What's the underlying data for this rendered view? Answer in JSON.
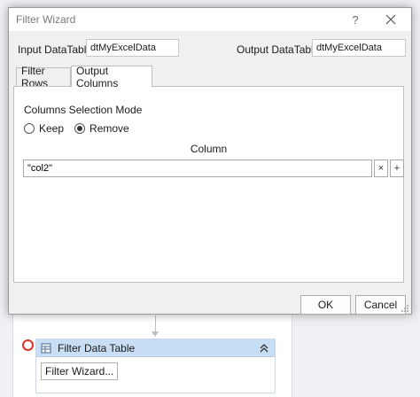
{
  "dialog": {
    "title": "Filter Wizard",
    "help_glyph": "?",
    "input_label": "Input DataTable",
    "input_value": "dtMyExcelData",
    "output_label": "Output DataTable",
    "output_value": "dtMyExcelData",
    "tabs": [
      {
        "label": "Filter Rows",
        "active": false
      },
      {
        "label": "Output Columns",
        "active": true
      }
    ],
    "mode_label": "Columns Selection Mode",
    "radio_keep": "Keep",
    "radio_remove": "Remove",
    "selected_mode": "Remove",
    "column_header": "Column",
    "column_value": "\"col2\"",
    "remove_glyph": "×",
    "add_glyph": "+",
    "ok_label": "OK",
    "cancel_label": "Cancel"
  },
  "designer": {
    "activity_title": "Filter Data Table",
    "activity_button": "Filter Wizard..."
  },
  "colors": {
    "activity_header": "#c7def5",
    "error_indicator": "#e0332c",
    "dialog_bg": "#f0f0f0"
  },
  "icons": [
    "close-icon",
    "help-icon",
    "table-icon",
    "collapse-icon",
    "error-indicator-icon",
    "resize-grip-icon"
  ]
}
